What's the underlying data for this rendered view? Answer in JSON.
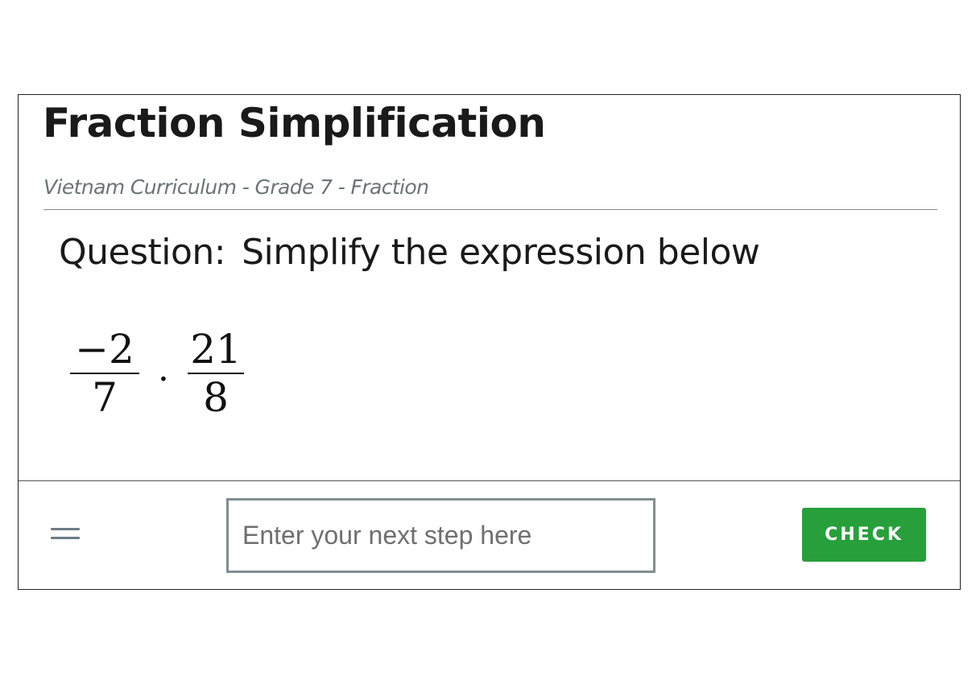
{
  "header": {
    "title": "Fraction Simplification",
    "breadcrumb": "Vietnam Curriculum - Grade 7 - Fraction"
  },
  "question": {
    "label": "Question:",
    "text": "Simplify the expression below"
  },
  "expression": {
    "fraction1": {
      "numerator": "−2",
      "denominator": "7"
    },
    "operator": "·",
    "fraction2": {
      "numerator": "21",
      "denominator": "8"
    }
  },
  "footer": {
    "menu_icon": "hamburger-menu-icon",
    "step_input": {
      "value": "",
      "placeholder": "Enter your next step here"
    },
    "check_label": "CHECK"
  },
  "colors": {
    "check_button": "#27a03b",
    "breadcrumb_text": "#6b7477",
    "input_border": "#7f8f92"
  }
}
